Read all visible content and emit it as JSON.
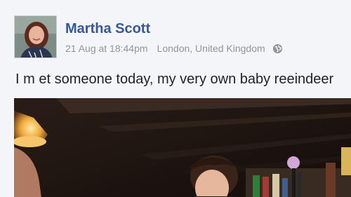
{
  "post": {
    "author_name": "Martha Scott",
    "date": "21 Aug at 18:44pm",
    "location": "London, United Kingdom",
    "privacy_icon": "globe-icon",
    "text": "I m et someone today, my very own baby reeindeer"
  },
  "colors": {
    "author_link": "#365899",
    "meta_text": "#90949c",
    "body_text": "#1d2129",
    "card_background": "#f4f5f8"
  }
}
